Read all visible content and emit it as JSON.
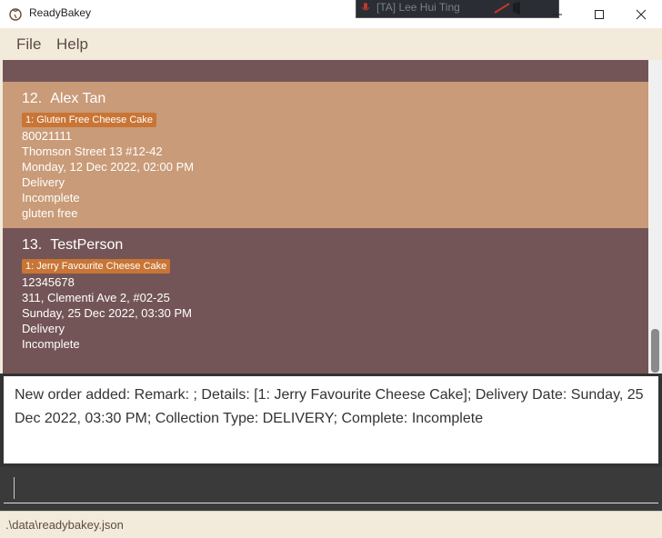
{
  "window": {
    "title": "ReadyBakey",
    "overlay_name": "[TA] Lee Hui Ting"
  },
  "menu": {
    "file": "File",
    "help": "Help"
  },
  "orders": [
    {
      "index": "12.",
      "name": "Alex Tan",
      "tag": "1: Gluten Free Cheese Cake",
      "phone": "80021111",
      "address": "Thomson Street 13 #12-42",
      "date": "Monday, 12 Dec 2022, 02:00 PM",
      "collection": "Delivery",
      "status": "Incomplete",
      "remark": "gluten free"
    },
    {
      "index": "13.",
      "name": "TestPerson",
      "tag": "1: Jerry Favourite Cheese Cake",
      "phone": "12345678",
      "address": "311, Clementi Ave 2, #02-25",
      "date": "Sunday, 25 Dec 2022, 03:30 PM",
      "collection": "Delivery",
      "status": "Incomplete"
    }
  ],
  "result": {
    "text": "New order added: Remark: ; Details: [1: Jerry Favourite Cheese Cake]; Delivery Date: Sunday, 25 Dec 2022, 03:30 PM; Collection Type: DELIVERY; Complete: Incomplete"
  },
  "command": {
    "value": ""
  },
  "status": {
    "path": ".\\data\\readybakey.json"
  },
  "colors": {
    "card_light": "#c99b78",
    "card_dark": "#745557",
    "tag": "#c87535",
    "cream": "#f2ebdc"
  },
  "icons": {
    "app": "app-logo-icon",
    "minimize": "minimize-icon",
    "maximize": "maximize-icon",
    "close": "close-icon"
  }
}
